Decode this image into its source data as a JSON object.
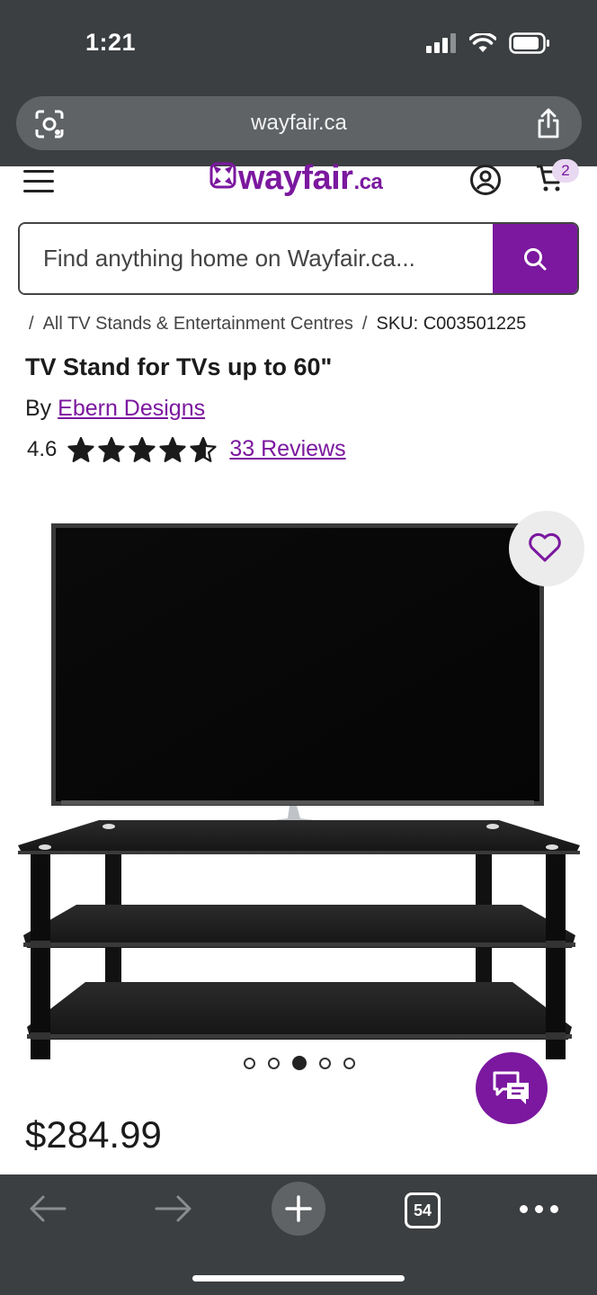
{
  "status_bar": {
    "time": "1:21"
  },
  "browser": {
    "url": "wayfair.ca",
    "tabs_count": "54"
  },
  "header": {
    "logo_text": "wayfair",
    "logo_suffix": ".ca",
    "cart_count": "2"
  },
  "search": {
    "placeholder": "Find anything home on Wayfair.ca..."
  },
  "breadcrumb": {
    "sep": "/",
    "category": "All TV Stands & Entertainment Centres",
    "sku": "SKU: C003501225"
  },
  "product": {
    "title": "TV Stand for TVs up to 60\"",
    "by_label": "By",
    "brand": "Ebern Designs",
    "rating": "4.6",
    "stars_filled": 4.6,
    "reviews": "33 Reviews",
    "price": "$284.99",
    "image_count": 5,
    "active_image": 3
  },
  "colors": {
    "brand": "#7b189f",
    "chrome": "#3c3f41"
  }
}
